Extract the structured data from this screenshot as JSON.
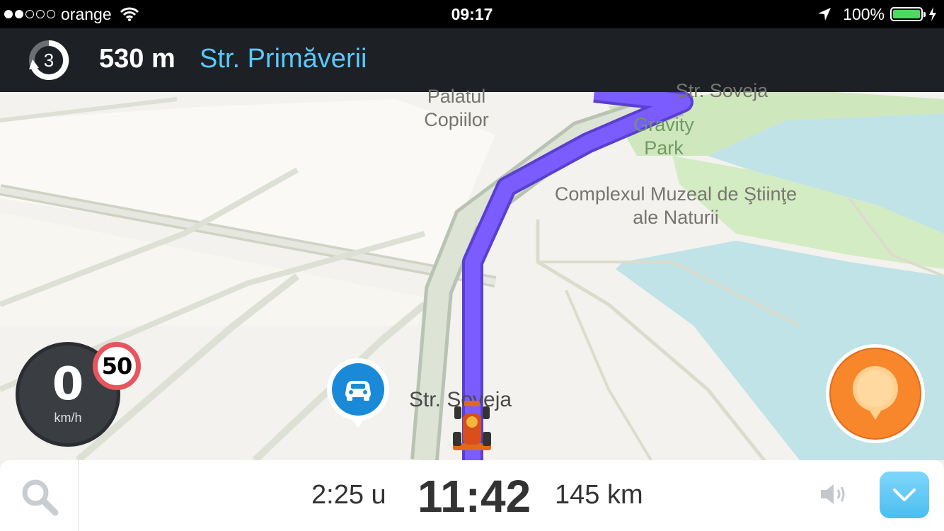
{
  "status_bar": {
    "carrier": "orange",
    "time": "09:17",
    "battery": "100%",
    "battery_level": 1.0,
    "signal_bars_filled": 2,
    "signal_bars_total": 5
  },
  "nav_header": {
    "roundabout_exit": "3",
    "distance": "530 m",
    "street": "Str. Primăverii"
  },
  "map": {
    "labels": {
      "palatul": "Palatul",
      "copiilor": "Copiilor",
      "top_street": "Str. Soveja",
      "gravity": "Gravity",
      "park": "Park",
      "muzeal_line1": "Complexul Muzeal de Ştiinţe",
      "muzeal_line2": "ale Naturii",
      "current_street": "Str. Soveja"
    }
  },
  "speed": {
    "value": "0",
    "unit": "km/h",
    "limit": "50"
  },
  "icons": {
    "car_pin": "car-icon",
    "report": "report-pin-icon",
    "vehicle": "racecar-icon",
    "search": "search-icon",
    "sound": "speaker-icon",
    "expand": "chevron-down-icon"
  },
  "bottom_bar": {
    "duration": "2:25 u",
    "arrival_time": "11:42",
    "remaining_distance": "145 km"
  },
  "colors": {
    "route": "#7a5cff",
    "header_bg": "#1d2126",
    "street_accent": "#5ac8fa",
    "speed_limit_ring": "#e8555f",
    "report_button": "#f7872a",
    "expand_button": "#5ac8fa"
  }
}
